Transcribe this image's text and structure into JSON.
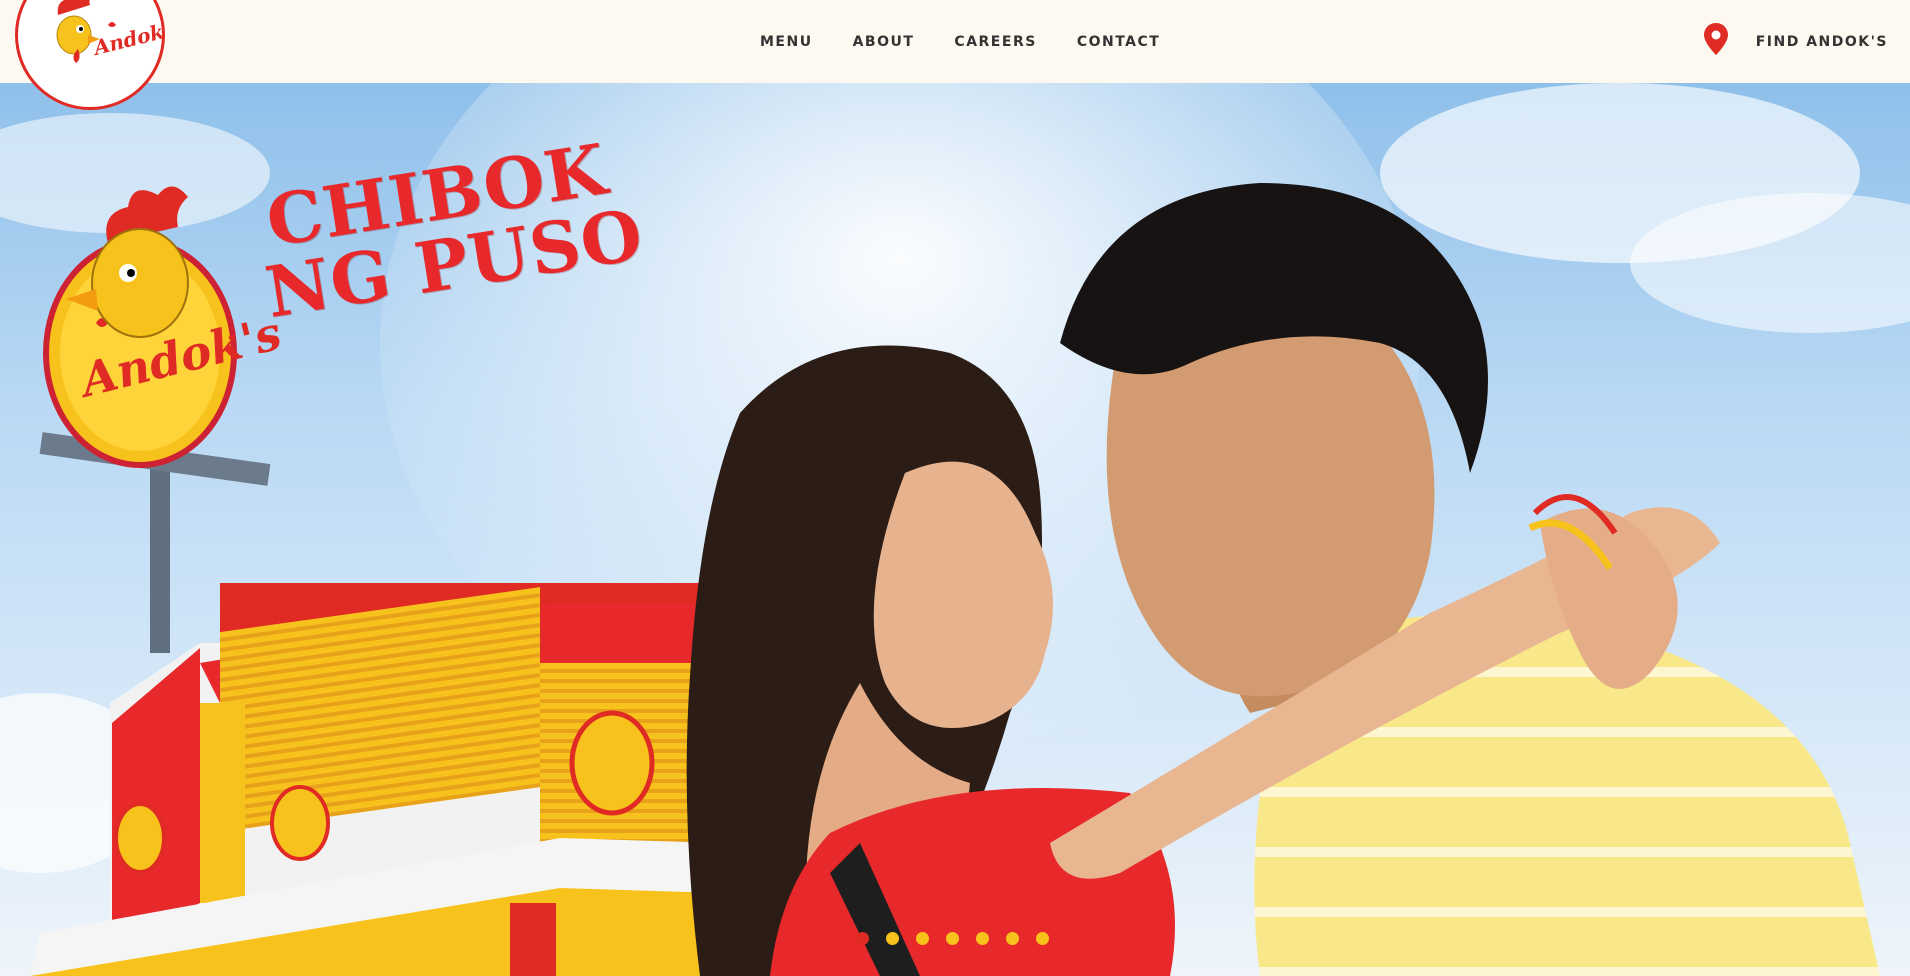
{
  "brand": {
    "name": "Andok's",
    "accent": "#e02a24",
    "yellow": "#f7c21b"
  },
  "nav": {
    "items": [
      {
        "label": "MENU"
      },
      {
        "label": "ABOUT"
      },
      {
        "label": "CAREERS"
      },
      {
        "label": "CONTACT"
      }
    ]
  },
  "find": {
    "label": "FIND ANDOK'S",
    "icon": "location-pin-icon"
  },
  "hero": {
    "headline_line1": "CHIBOK",
    "headline_line2": "NG PUSO",
    "store_sign": "Andok's"
  },
  "carousel": {
    "active_index": 0,
    "slide_count": 7,
    "active_color": "#e02a24",
    "inactive_color": "#f7c21b"
  }
}
